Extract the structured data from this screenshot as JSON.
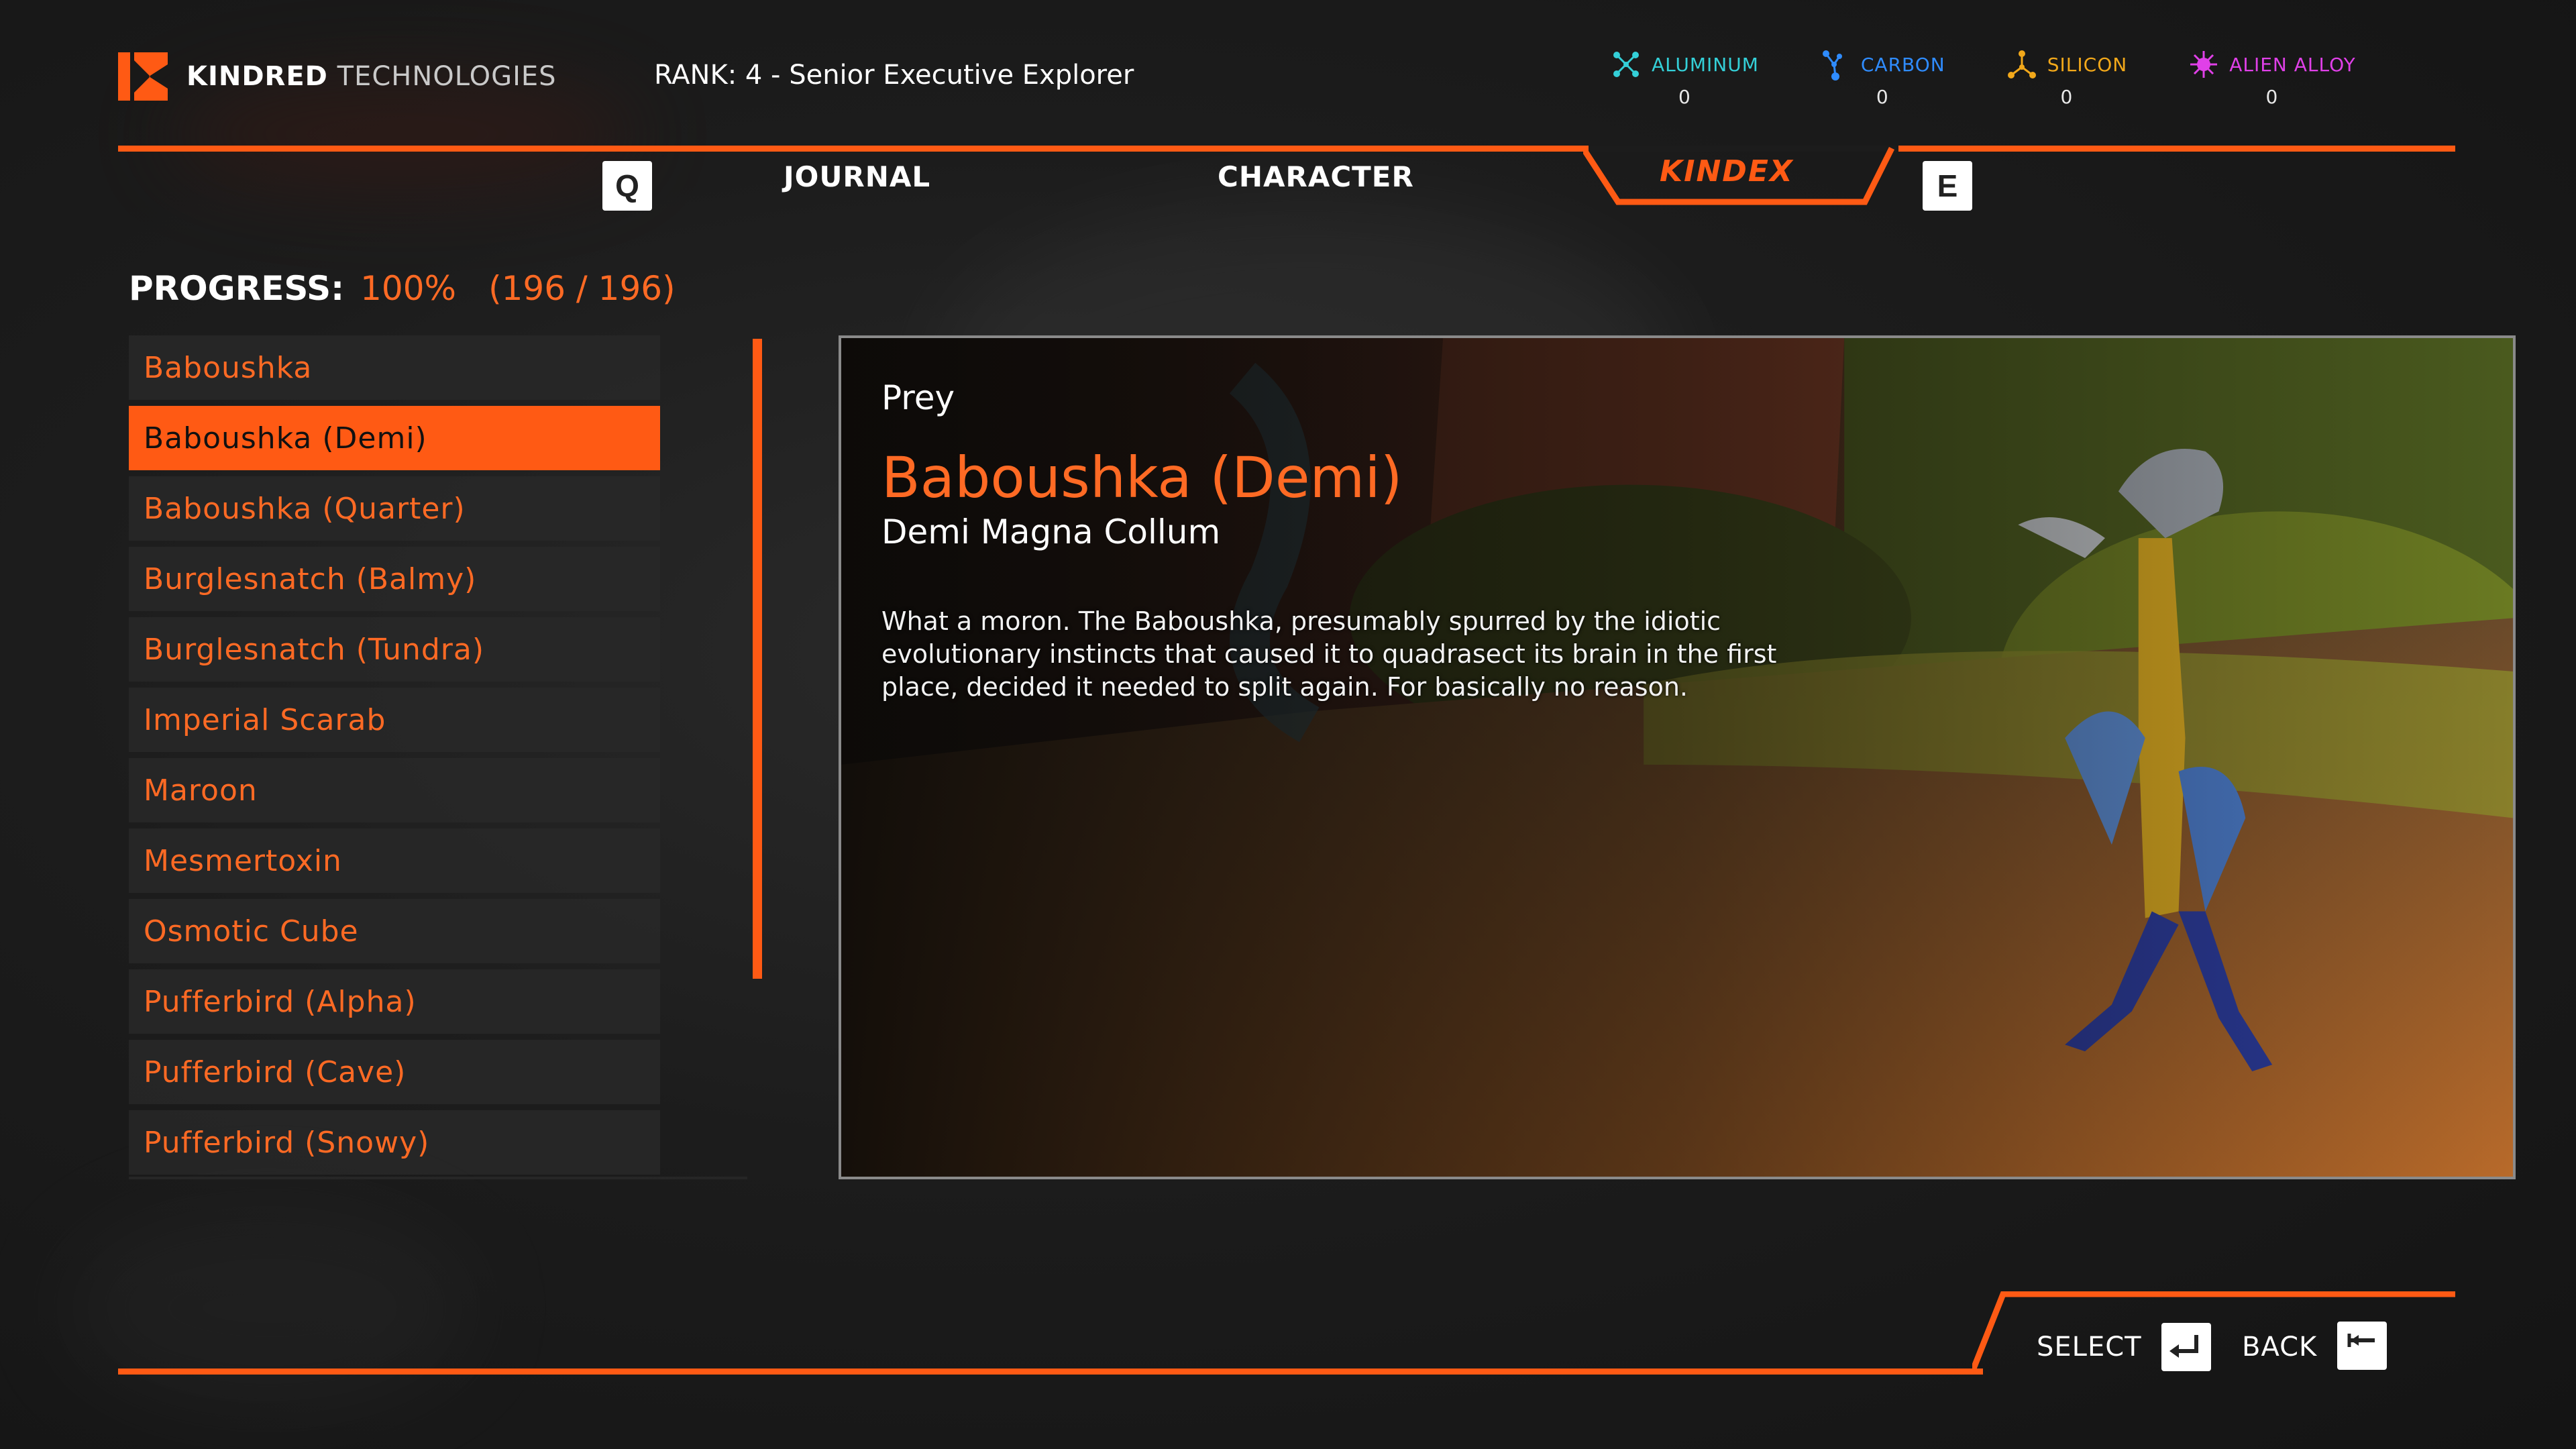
{
  "header": {
    "brand_part1": "KINDRED",
    "brand_part2": "TECHNOLOGIES",
    "rank_label": "RANK:",
    "rank_value": "4 - Senior Executive Explorer"
  },
  "resources": [
    {
      "name": "ALUMINUM",
      "value": "0",
      "color": "#34d0d8",
      "icon": "aluminum-molecule-icon"
    },
    {
      "name": "CARBON",
      "value": "0",
      "color": "#2f8cff",
      "icon": "carbon-molecule-icon"
    },
    {
      "name": "SILICON",
      "value": "0",
      "color": "#f2a81a",
      "icon": "silicon-molecule-icon"
    },
    {
      "name": "ALIEN ALLOY",
      "value": "0",
      "color": "#e040e8",
      "icon": "alien-alloy-icon"
    }
  ],
  "nav": {
    "prev_key": "Q",
    "next_key": "E",
    "tabs": [
      {
        "label": "JOURNAL",
        "active": false
      },
      {
        "label": "CHARACTER",
        "active": false
      },
      {
        "label": "KINDEX",
        "active": true
      }
    ]
  },
  "progress": {
    "label": "PROGRESS:",
    "percent": "100%",
    "count": "(196 / 196)"
  },
  "creature_list": [
    {
      "label": "Baboushka",
      "selected": false
    },
    {
      "label": "Baboushka (Demi)",
      "selected": true
    },
    {
      "label": "Baboushka (Quarter)",
      "selected": false
    },
    {
      "label": "Burglesnatch (Balmy)",
      "selected": false
    },
    {
      "label": "Burglesnatch (Tundra)",
      "selected": false
    },
    {
      "label": "Imperial Scarab",
      "selected": false
    },
    {
      "label": "Maroon",
      "selected": false
    },
    {
      "label": "Mesmertoxin",
      "selected": false
    },
    {
      "label": "Osmotic Cube",
      "selected": false
    },
    {
      "label": "Pufferbird (Alpha)",
      "selected": false
    },
    {
      "label": "Pufferbird (Cave)",
      "selected": false
    },
    {
      "label": "Pufferbird (Snowy)",
      "selected": false
    }
  ],
  "detail": {
    "type": "Prey",
    "name": "Baboushka (Demi)",
    "scientific_name": "Demi Magna Collum",
    "description": "What a moron. The Baboushka, presumably spurred by the idiotic evolutionary instincts that caused it to quadrasect its brain in the first place, decided it needed to split again. For basically no reason."
  },
  "footer": {
    "select_label": "SELECT",
    "back_label": "BACK"
  },
  "colors": {
    "accent": "#ff5a14",
    "accent_text": "#ff6a24"
  }
}
